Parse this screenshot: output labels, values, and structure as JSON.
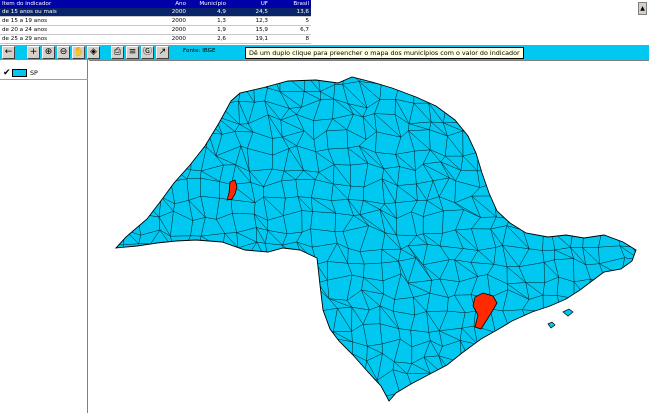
{
  "colors": {
    "map_fill": "#00c8f0",
    "highlight": "#ff2a00",
    "header_bg": "#0000a8",
    "selected_row_bg": "#0a246a",
    "toolbar_bg": "#00c8f0",
    "tooltip_bg": "#ffffe1"
  },
  "table": {
    "headers": [
      "Item do indicador",
      "Ano",
      "Município",
      "UF",
      "Brasil"
    ],
    "rows": [
      [
        "de 15 anos ou mais",
        "2000",
        "4,9",
        "24,5",
        "13,6"
      ],
      [
        "de 15 a 19 anos",
        "2000",
        "1,3",
        "12,3",
        "5"
      ],
      [
        "de 20 a 24 anos",
        "2000",
        "1,9",
        "15,9",
        "6,7"
      ],
      [
        "de 25 a 29 anos",
        "2000",
        "2,6",
        "19,1",
        "8"
      ]
    ],
    "selected_row": 0
  },
  "toolbar": {
    "buttons": [
      {
        "name": "back-button",
        "icon": "arrow-left-icon",
        "glyph": "←"
      },
      {
        "name": "add-layer-button",
        "icon": "plus-icon",
        "glyph": "+"
      },
      {
        "name": "zoom-in-button",
        "icon": "zoom-in-icon",
        "glyph": "⊕"
      },
      {
        "name": "zoom-out-button",
        "icon": "zoom-out-icon",
        "glyph": "⊖"
      },
      {
        "name": "pan-button",
        "icon": "hand-icon",
        "glyph": "✋"
      },
      {
        "name": "full-extent-button",
        "icon": "full-extent-icon",
        "glyph": "◈"
      },
      {
        "name": "print-button",
        "icon": "printer-icon",
        "glyph": "⎙"
      },
      {
        "name": "legend-button",
        "icon": "list-icon",
        "glyph": "≡"
      },
      {
        "name": "info-button",
        "icon": "globe-icon",
        "glyph": "Ⓖ"
      },
      {
        "name": "chart-button",
        "icon": "chart-icon",
        "glyph": "↗"
      }
    ],
    "source_label": "Fonte: IBGE",
    "tooltip": "Dê um duplo clique para preencher o mapa dos municípios com o valor do indicador"
  },
  "legend": {
    "check_icon": "check-icon",
    "label": "SP"
  },
  "scroll_icon": "scroll-up-icon"
}
